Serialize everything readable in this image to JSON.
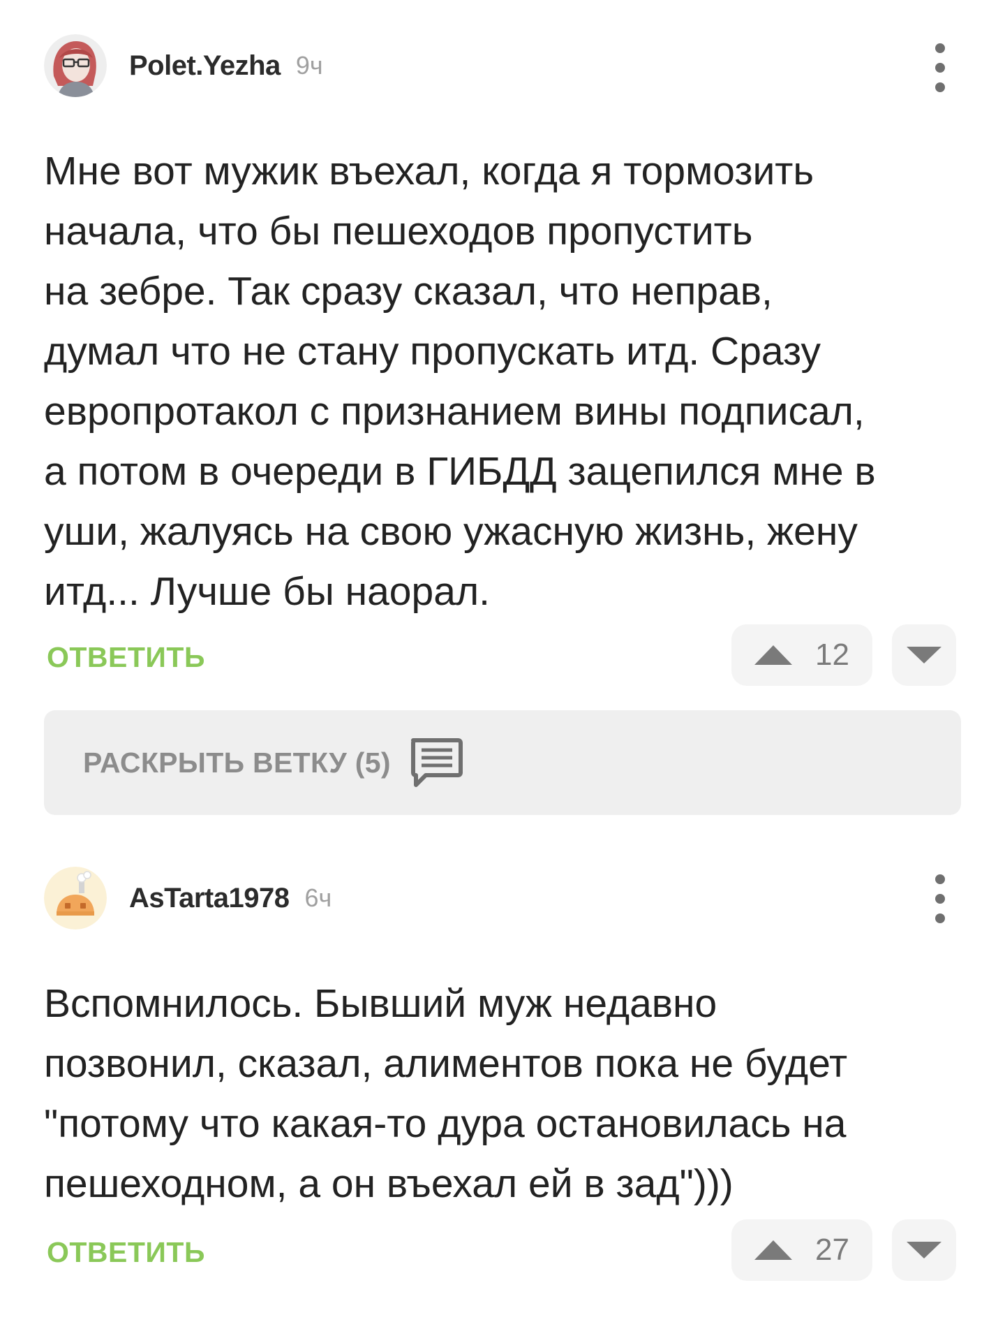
{
  "comments": [
    {
      "username": "Polet.Yezha",
      "time": "9ч",
      "text": "Мне вот мужик въехал, когда я тормозить\nначала, что бы пешеходов пропустить\nна зебре. Так сразу сказал, что неправ,\nдумал что не стану пропускать итд. Сразу\nевропротакол с признанием вины подписал,\nа потом в очереди в ГИБДД зацепился мне в\nуши, жалуясь на свою ужасную жизнь, жену\nитд... Лучше бы наорал.",
      "reply_label": "ОТВЕТИТЬ",
      "rating": "12",
      "avatar_icon": "woman-glasses-avatar"
    },
    {
      "username": "AsTarta1978",
      "time": "6ч",
      "text": "Вспомнилось. Бывший муж недавно\nпозвонил, сказал, алиментов пока не будет\n\"потому что какая-то дура остановилась на\nпешеходном, а он въехал ей в зад\")))",
      "reply_label": "ОТВЕТИТЬ",
      "rating": "27",
      "avatar_icon": "house-avatar"
    }
  ],
  "thread": {
    "label": "РАСКРЫТЬ ВЕТКУ (5)",
    "icon": "comment-icon"
  },
  "colors": {
    "accent_green": "#8ac858",
    "text": "#222222",
    "muted": "#a0a0a0",
    "button_bg": "#f4f4f4",
    "thread_bg": "#efefef"
  }
}
